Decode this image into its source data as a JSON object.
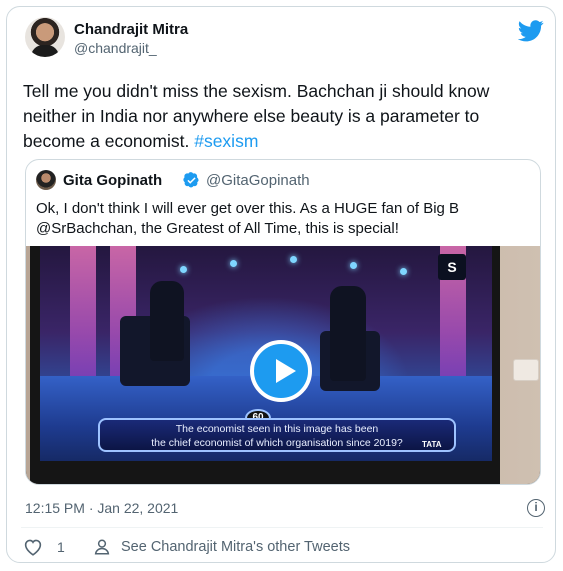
{
  "author": {
    "name": "Chandrajit Mitra",
    "handle": "@chandrajit_"
  },
  "tweet": {
    "text": "Tell me you didn't miss the sexism. Bachchan ji should know neither in India nor anywhere else beauty is a parameter to become a economist.",
    "hashtag": "#sexism"
  },
  "quoted_tweet": {
    "name": "Gita Gopinath",
    "handle": "@GitaGopinath",
    "text": "Ok, I don't think I will ever get over this. As a HUGE fan of Big B @SrBachchan, the Greatest of All Time, this is special!",
    "media": {
      "timer": "60",
      "question_line1": "The economist seen in this image has been",
      "question_line2": "the chief economist of which organisation since 2019?",
      "sponsor": "TATA",
      "channel_mark": "S"
    }
  },
  "meta": {
    "timestamp": "12:15 PM · Jan 22, 2021"
  },
  "actions": {
    "like_count": "1",
    "see_tweets_label": "See Chandrajit Mitra's other Tweets"
  },
  "colors": {
    "accent": "#1d9bf0",
    "secondary_text": "#536471",
    "border": "#cfd9de"
  },
  "icons": {
    "brand": "twitter-bird-icon",
    "verified": "verified-badge-icon",
    "play": "play-icon",
    "info": "info-icon",
    "like": "heart-icon",
    "profile": "person-icon"
  }
}
